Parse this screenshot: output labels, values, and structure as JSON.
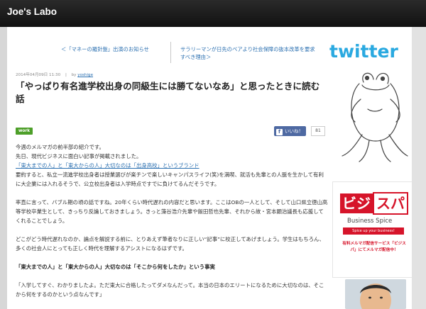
{
  "header": {
    "site_title": "Joe's Labo"
  },
  "related": {
    "left": "＜「マネーの羅針盤」出演のお知らせ",
    "right": "サラリーマンが日先のベアより社会保障の抜本改革を要求すべき理由＞"
  },
  "post": {
    "date": "2014年04月09日 11:30",
    "by_label": "by",
    "author": "yoshige",
    "title": "「やっぱり有名進学校出身の同級生には勝てないなあ」と思ったときに読む話",
    "tag": "work",
    "fb_like": "いいね！",
    "fb_count": "81"
  },
  "body": {
    "p1": "今週のメルマガの前半部の紹介です。",
    "p2": "先日、現代ビジネスに面白い記事が掲載されました。",
    "link": "「東大までの人」と「東大からの人」大切なのは「出身高校」というブランド",
    "p3": "要約すると、私立一流進学校出身者は授業選びが楽チンで楽しいキャンパスライフ(笑)を満喫、就活も先輩との人脈を生かして有利に大企業には入れるそうで、公立校出身者は入学時点ですでに負けてるんだそうです。",
    "p4": "率直に言って、バブル期の頃の話ですね。20年くらい時代遅れの内容だと思います。ここはOBの一人として、そして山口県立徳山高等学校卒業生として、きっちり反論しておきましょう。きっと藻谷浩介先輩や飯田哲也先輩、それから故・宮本顕治議長も応援してくれることでしょう。",
    "p5": "どこがどう時代遅れなのか、論点を解説する前に、とりあえず筆者なりに正しい“記事”に校正してあげましょう。学生はもちろん、多くの社会人にとっても正しく時代を理解するアシストになるはずです。",
    "heading": "「東大までの人」と「東大からの人」大切なのは「そこから何をしたか」という事実",
    "p6": "「入学してすぐ、わかりましたよ。ただ東大に合格したってダメなんだって。本当の日本のエリートになるために大切なのは、そこから何をするのかという点なんです」"
  },
  "sidebar": {
    "twitter": "twitter",
    "bizspa_a": "ビジ",
    "bizspa_b": "スパ",
    "bizspa_sub": "Business Spice",
    "bizspa_tag": "Spice up your business!",
    "bizspa_note": "有料メルマガ配信サービス「ビジスパ」にてメルマガ配信中！"
  },
  "icons": {
    "facebook": "facebook-f-icon",
    "frog": "frog-illustration-icon"
  },
  "colors": {
    "link": "#2a6fb0",
    "twitter": "#2aa9e0",
    "bizspa": "#d6142a",
    "tag": "#4d9f29"
  }
}
